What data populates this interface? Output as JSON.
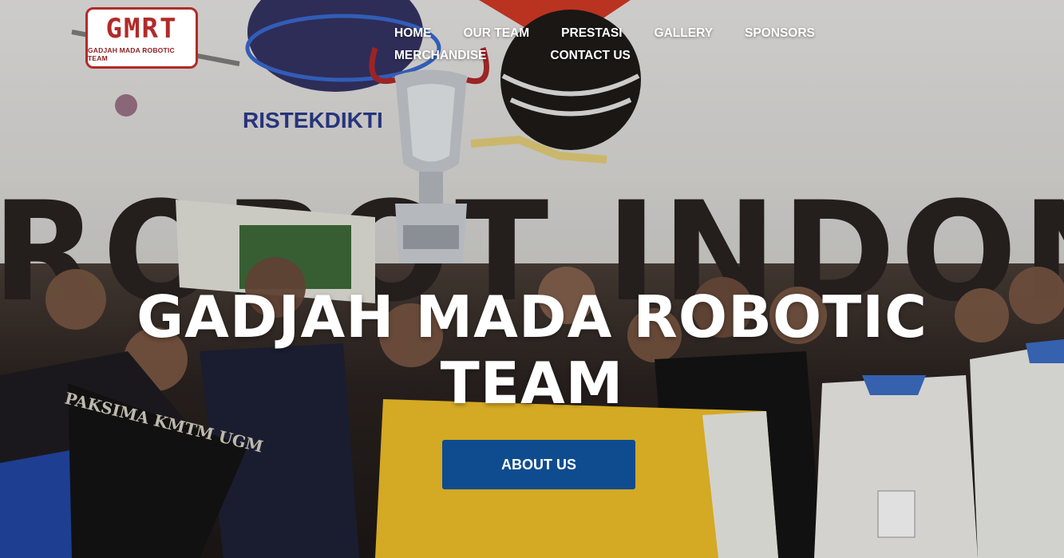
{
  "brand": {
    "logo_mark": "GMRT",
    "logo_sub": "GADJAH MADA ROBOTIC TEAM"
  },
  "nav": {
    "items": [
      {
        "label": "HOME"
      },
      {
        "label": "OUR TEAM"
      },
      {
        "label": "PRESTASI"
      },
      {
        "label": "GALLERY"
      },
      {
        "label": "SPONSORS"
      },
      {
        "label": "MERCHANDISE"
      },
      {
        "label": "CONTACT US"
      }
    ]
  },
  "hero": {
    "title_line1": "GADJAH MADA ROBOTIC",
    "title_line2": "TEAM",
    "cta_label": "ABOUT US",
    "background_text": {
      "sponsor_logo": "RISTEKDIKTI",
      "banner": "ROBOT INDONESIA",
      "shirt_slogan": "PAKSIMA KMTM UGM"
    }
  },
  "colors": {
    "accent": "#0e4c8f",
    "logo_red": "#b22a2a",
    "text_on_hero": "#ffffff"
  },
  "icons": {
    "trophy": "trophy-icon",
    "logo": "gmrt-logo"
  }
}
